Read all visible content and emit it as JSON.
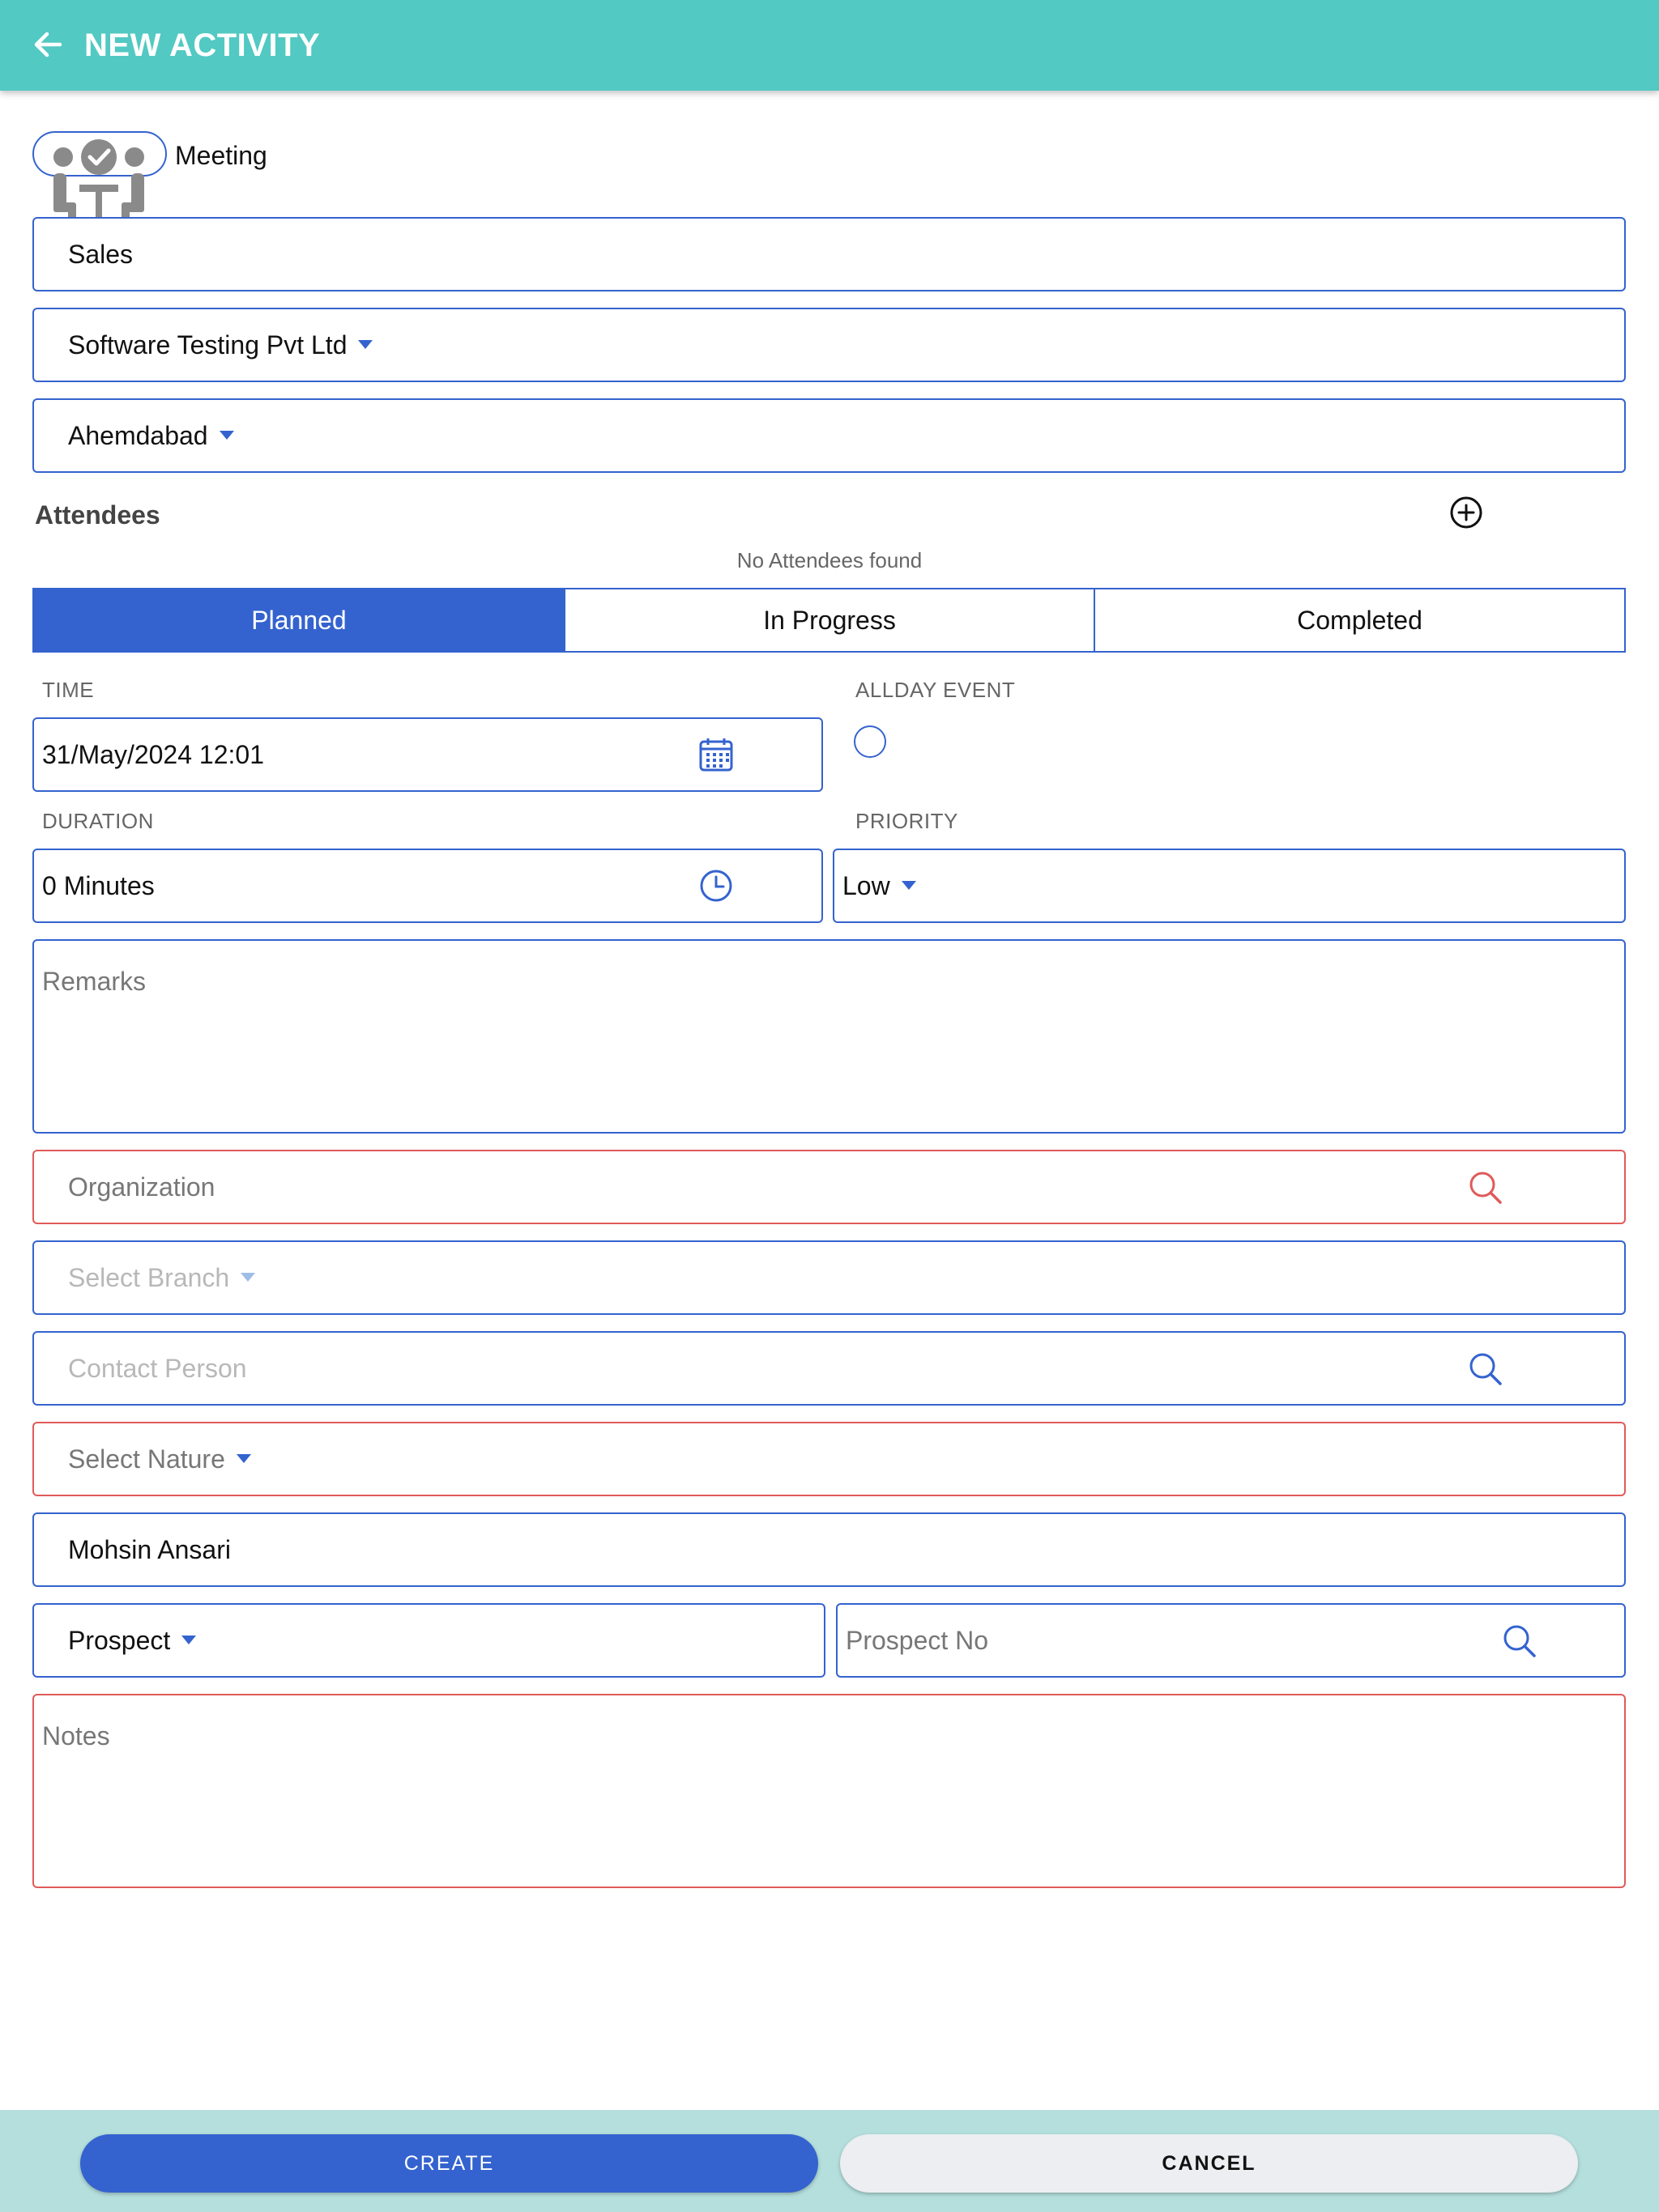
{
  "header": {
    "title": "NEW ACTIVITY"
  },
  "activity_type": {
    "label": "Meeting"
  },
  "fields": {
    "category": "Sales",
    "company": "Software Testing Pvt Ltd",
    "branch": "Ahemdabad"
  },
  "attendees": {
    "title": "Attendees",
    "empty": "No Attendees found"
  },
  "status_tabs": [
    "Planned",
    "In Progress",
    "Completed"
  ],
  "time": {
    "caption": "TIME",
    "value": "31/May/2024 12:01"
  },
  "allday": {
    "caption": "ALLDAY EVENT"
  },
  "duration": {
    "caption": "DURATION",
    "value": "0 Minutes"
  },
  "priority": {
    "caption": "PRIORITY",
    "value": "Low"
  },
  "remarks": {
    "placeholder": "Remarks"
  },
  "organization": {
    "placeholder": "Organization"
  },
  "select_branch": {
    "placeholder": "Select Branch"
  },
  "contact_person": {
    "placeholder": "Contact Person"
  },
  "nature": {
    "placeholder": "Select Nature"
  },
  "owner": {
    "value": "Mohsin Ansari"
  },
  "prospect": {
    "value": "Prospect",
    "no_placeholder": "Prospect No"
  },
  "notes": {
    "placeholder": "Notes"
  },
  "actions": {
    "create": "CREATE",
    "cancel": "CANCEL"
  },
  "colors": {
    "header": "#52c9c2",
    "accent": "#3463cf",
    "error": "#e05a5a",
    "footer": "#b4dfdd"
  },
  "icons": [
    "back-arrow-icon",
    "meeting-icon",
    "chevron-down-icon",
    "add-circle-icon",
    "calendar-icon",
    "clock-icon",
    "search-icon"
  ]
}
